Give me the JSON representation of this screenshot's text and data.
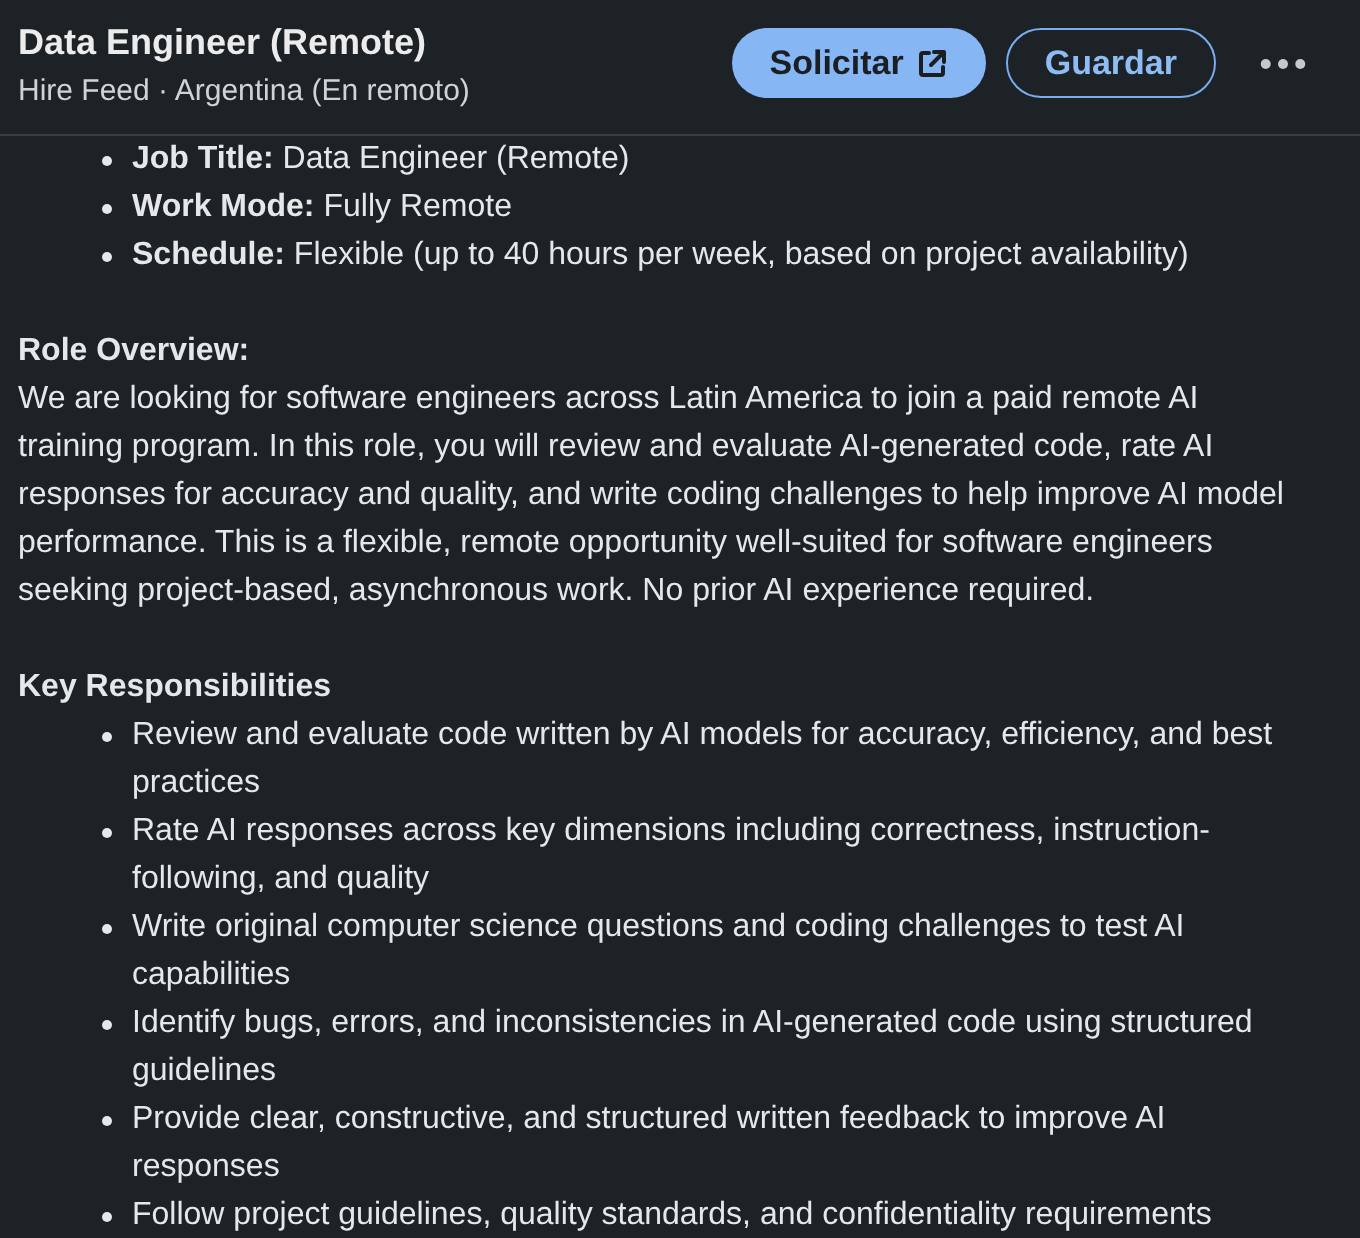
{
  "header": {
    "title": "Data Engineer (Remote)",
    "subtitle": "Hire Feed · Argentina (En remoto)",
    "actions": [
      {
        "kind": "primary",
        "label": "Solicitar",
        "external": true
      },
      {
        "kind": "outline",
        "label": "Guardar"
      },
      {
        "kind": "more"
      }
    ]
  },
  "body": [
    {
      "kind": "list",
      "items": [
        "**Job Title:** Data Engineer (Remote)",
        "**Work Mode:** Fully Remote",
        "**Schedule:** Flexible (up to 40 hours per week, based on project availability)"
      ]
    },
    {
      "kind": "heading",
      "text": "Role Overview:"
    },
    {
      "kind": "paragraph",
      "text": "We are looking for software engineers across Latin America to join a paid remote AI training program. In this role, you will review and evaluate AI-generated code, rate AI responses for accuracy and quality, and write coding challenges to help improve AI model performance. This is a flexible, remote opportunity well-suited for software engineers seeking project-based, asynchronous work. No prior AI experience required."
    },
    {
      "kind": "heading",
      "text": "Key Responsibilities"
    },
    {
      "kind": "list",
      "items": [
        "Review and evaluate code written by AI models for accuracy, efficiency, and best practices",
        "Rate AI responses across key dimensions including correctness, instruction-following, and quality",
        "Write original computer science questions and coding challenges to test AI capabilities",
        "Identify bugs, errors, and inconsistencies in AI-generated code using structured guidelines",
        "Provide clear, constructive, and structured written feedback to improve AI responses",
        "Follow project guidelines, quality standards, and confidentiality requirements"
      ]
    }
  ]
}
